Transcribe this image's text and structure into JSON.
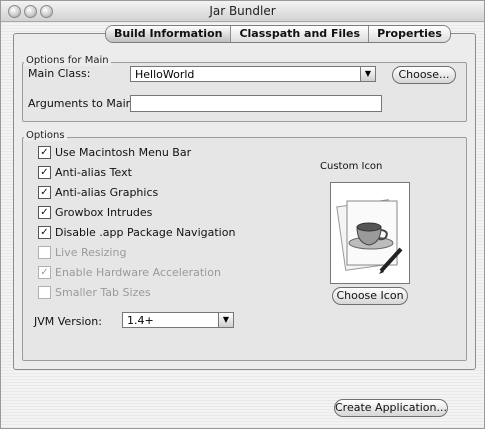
{
  "window": {
    "title": "Jar Bundler"
  },
  "tabs": [
    {
      "label": "Build Information",
      "selected": true
    },
    {
      "label": "Classpath and Files",
      "selected": false
    },
    {
      "label": "Properties",
      "selected": false
    }
  ],
  "main_options": {
    "group_label": "Options for Main",
    "main_class_label": "Main Class:",
    "main_class_value": "HelloWorld",
    "choose_button": "Choose...",
    "arguments_label": "Arguments to Main:",
    "arguments_value": ""
  },
  "options": {
    "group_label": "Options",
    "checkboxes": [
      {
        "label": "Use Macintosh Menu Bar",
        "checked": true,
        "enabled": true
      },
      {
        "label": "Anti-alias Text",
        "checked": true,
        "enabled": true
      },
      {
        "label": "Anti-alias Graphics",
        "checked": true,
        "enabled": true
      },
      {
        "label": "Growbox Intrudes",
        "checked": true,
        "enabled": true
      },
      {
        "label": "Disable .app Package Navigation",
        "checked": true,
        "enabled": true
      },
      {
        "label": "Live Resizing",
        "checked": false,
        "enabled": false
      },
      {
        "label": "Enable Hardware Acceleration",
        "checked": true,
        "enabled": false
      },
      {
        "label": "Smaller Tab Sizes",
        "checked": false,
        "enabled": false
      }
    ],
    "jvm_label": "JVM Version:",
    "jvm_value": "1.4+",
    "custom_icon_label": "Custom Icon",
    "choose_icon_button": "Choose Icon"
  },
  "footer": {
    "create_button": "Create Application..."
  }
}
